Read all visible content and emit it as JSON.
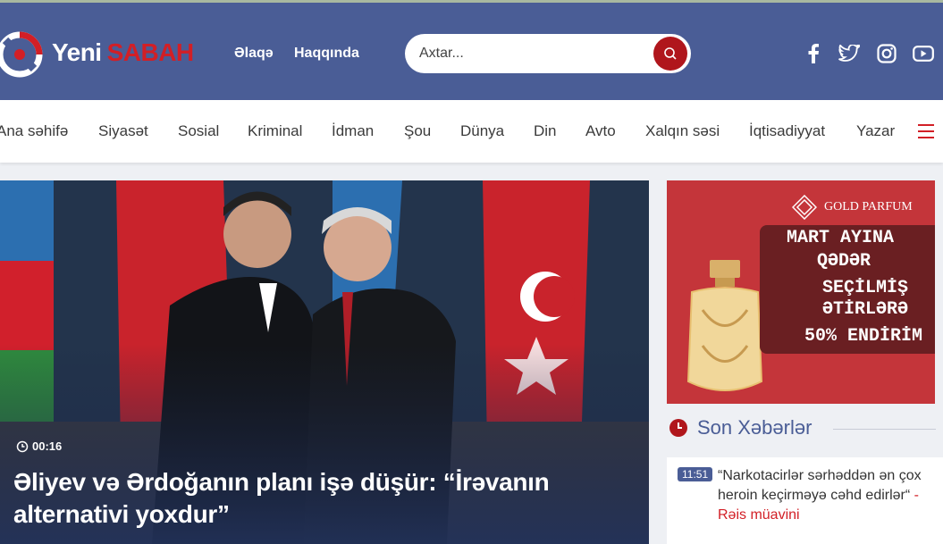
{
  "header": {
    "logo_part1": "Yeni",
    "logo_part2": "SABAH",
    "links": [
      "Əlaqə",
      "Haqqında"
    ],
    "search_placeholder": "Axtar...",
    "social": [
      "facebook-icon",
      "twitter-icon",
      "instagram-icon",
      "youtube-icon"
    ]
  },
  "nav": {
    "items": [
      "Ana səhifə",
      "Siyasət",
      "Sosial",
      "Kriminal",
      "İdman",
      "Şou",
      "Dünya",
      "Din",
      "Avto",
      "Xalqın səsi",
      "İqtisadiyyat",
      "Yazar"
    ]
  },
  "hero": {
    "time": "00:16",
    "title": "Əliyev və Ərdoğanın planı işə düşür: “İrəvanın alternativi yoxdur”"
  },
  "ad": {
    "brand": "GOLD PARFUM",
    "lines": [
      "MART AYINA",
      "QƏDƏR",
      "SEÇİLMİŞ",
      "ƏTİRLƏRƏ",
      "50% ENDİRİM"
    ]
  },
  "latest": {
    "title": "Son Xəbərlər",
    "items": [
      {
        "time": "11:51",
        "text": "“Narkotacirlər sərhəddən ən çox heroin keçirməyə cəhd edirlər“",
        "tag": " - Rəis müavini"
      }
    ]
  },
  "colors": {
    "header_bg": "#4a5d96",
    "accent_red": "#d21f26"
  }
}
